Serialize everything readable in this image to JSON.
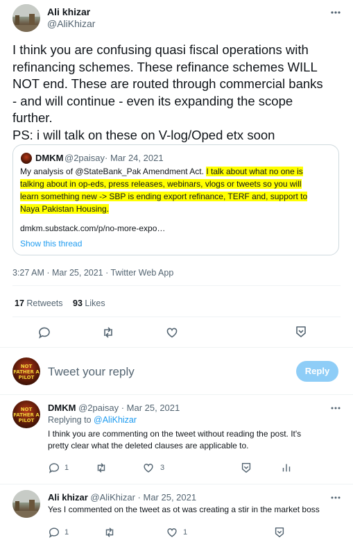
{
  "main_tweet": {
    "author_name": "Ali khizar",
    "author_handle": "@AliKhizar",
    "text_lines": [
      "I think you are confusing quasi fiscal operations with",
      "refinancing schemes. These refinance schemes WILL",
      "NOT end. These are routed through commercial banks",
      "- and will continue - even its expanding the scope",
      "further.",
      "PS: i will talk on these on V-log/Oped etx  soon"
    ],
    "timestamp": "3:27 AM · Mar 25, 2021 · Twitter Web App",
    "retweets_count": "17",
    "retweets_label": "Retweets",
    "likes_count": "93",
    "likes_label": "Likes"
  },
  "quoted_tweet": {
    "author_name": "DMKM",
    "author_handle": "@2paisay",
    "date": "· Mar 24, 2021",
    "line1_plain": "My analysis of @StateBank_Pak Amendment Act. ",
    "line1_highlight": "I talk about what no one is",
    "line2_highlight": "talking about in op-eds, press releases, webinars, vlogs or tweets so you will",
    "line3_highlight": "learn something new -> SBP is ending export refinance, TERF and, support to",
    "line4_highlight": "Naya Pakistan Housing.",
    "link": "dmkm.substack.com/p/no-more-expo…",
    "show_thread": "Show this thread"
  },
  "reply_box": {
    "placeholder": "Tweet your reply",
    "button_label": "Reply"
  },
  "replies": [
    {
      "author_name": "DMKM",
      "author_handle": "@2paisay",
      "date": "· Mar 25, 2021",
      "replying_to_label": "Replying to",
      "replying_to_handle": "@AliKhizar",
      "text_line1": "I think you are commenting on the tweet without reading the post. It's",
      "text_line2": "pretty clear what the deleted clauses are applicable to.",
      "reply_count": "1",
      "like_count": "3"
    },
    {
      "author_name": "Ali khizar",
      "author_handle": "@AliKhizar",
      "date": "· Mar 25, 2021",
      "text_line1": "Yes I commented on the tweet as ot was creating a stir in the market boss",
      "reply_count": "1",
      "like_count": "1"
    }
  ],
  "avatar_text": "NOT FATHER A PILOT",
  "colors": {
    "accent": "#1d9bf0",
    "reply_button_disabled": "#8ecdf7",
    "highlight": "#ffff00",
    "muted": "#536471",
    "separator": "#eff3f4"
  },
  "icons": [
    "more-icon",
    "reply-icon",
    "retweet-icon",
    "like-icon",
    "share-icon",
    "analytics-icon"
  ]
}
